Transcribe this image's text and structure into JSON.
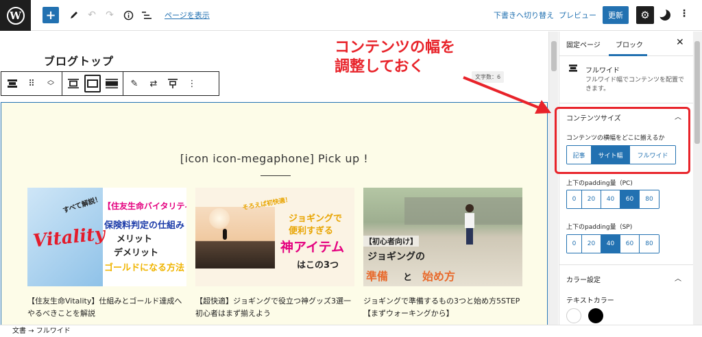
{
  "topbar": {
    "logo_letter": "W",
    "add_icon": "plus-icon",
    "view_page_label": "ページを表示",
    "switch_to_draft_label": "下書きへ切り替え",
    "preview_label": "プレビュー",
    "update_label": "更新"
  },
  "editor": {
    "page_title": "ブログトップ",
    "char_count": "文字数：6",
    "annotation": [
      "コンテンツの幅を",
      "調整しておく"
    ],
    "pickup_heading": "[icon icon-megaphone] Pick up !",
    "cards": [
      {
        "title": "【住友生命Vitality】仕組みとゴールド達成へやるべきことを解説",
        "thumb": {
          "tag": "すべて解説！",
          "logo": "Vitality",
          "line1": "【住友生命バイタリティ",
          "line2": "保険料判定の仕組み",
          "line3": "メリット",
          "line4": "デメリット",
          "line5": "ゴールドになる方法"
        }
      },
      {
        "title": "【超快適】ジョギングで役立つ神グッズ3選一初心者はまず揃えよう",
        "thumb": {
          "tag": "そろえば初快適！",
          "line1": "ジョギングで",
          "line2": "便利すぎる",
          "line3": "神アイテム",
          "line4": "はこの3つ"
        }
      },
      {
        "title": "ジョギングで準備するもの3つと始め方5STEP【まずウォーキングから】",
        "thumb": {
          "line1": "【初心者向け】",
          "line2": "ジョギングの",
          "line3": "準備",
          "line4": "と",
          "line5": "始め方"
        }
      }
    ]
  },
  "sidebar": {
    "tab_page": "固定ページ",
    "tab_block": "ブロック",
    "block_name": "フルワイド",
    "block_desc": "フルワイド幅でコンテンツを配置できます。",
    "content_size": {
      "title": "コンテンツサイズ",
      "label": "コンテンツの横幅をどこに揃えるか",
      "options": [
        "記事",
        "サイト幅",
        "フルワイド"
      ],
      "selected": "サイト幅"
    },
    "padding_pc": {
      "label": "上下のpadding量（PC)",
      "options": [
        "0",
        "20",
        "40",
        "60",
        "80"
      ],
      "selected": "60"
    },
    "padding_sp": {
      "label": "上下のpadding量（SP)",
      "options": [
        "0",
        "20",
        "40",
        "60",
        "80"
      ],
      "selected": "40"
    },
    "color_settings": {
      "title": "カラー設定",
      "text_color_label": "テキストカラー",
      "swatches": [
        "#ffffff",
        "#000000"
      ]
    }
  },
  "footer": {
    "breadcrumb": "文書 → フルワイド"
  },
  "colors": {
    "accent": "#2271b1",
    "annotation": "#e8232a",
    "block_bg": "#fdfce8"
  }
}
